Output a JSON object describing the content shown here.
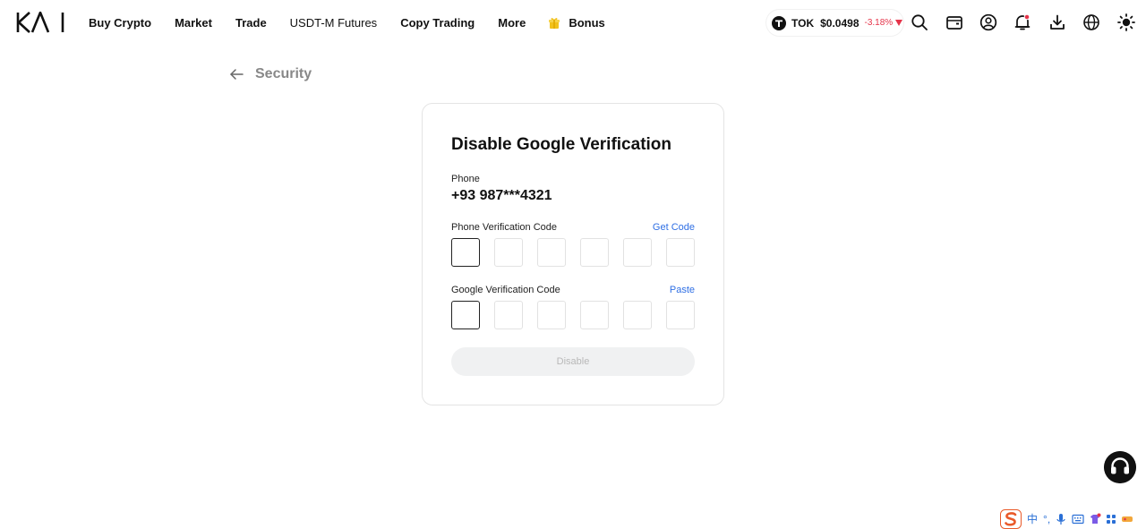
{
  "brand": {
    "logo_text": "KAI"
  },
  "nav": {
    "links": [
      {
        "label": "Buy Crypto"
      },
      {
        "label": "Market"
      },
      {
        "label": "Trade"
      },
      {
        "label": "USDT-M Futures"
      },
      {
        "label": "Copy Trading"
      },
      {
        "label": "More"
      }
    ],
    "bonus_label": "Bonus"
  },
  "ticker": {
    "symbol": "TOK",
    "price": "$0.0498",
    "change": "-3.18%"
  },
  "header_icons": [
    "search-icon",
    "wallet-icon",
    "account-icon",
    "notification-icon",
    "download-icon",
    "language-icon",
    "theme-icon"
  ],
  "page": {
    "section_title": "Security"
  },
  "card": {
    "title": "Disable Google Verification",
    "phone_label": "Phone",
    "phone_value": "+93 987***4321",
    "phone_code_label": "Phone Verification Code",
    "get_code_label": "Get Code",
    "google_code_label": "Google Verification Code",
    "paste_label": "Paste",
    "code_length": 6,
    "submit_label": "Disable"
  },
  "ime": {
    "items": [
      "中",
      "°,"
    ]
  },
  "colors": {
    "accent": "#2f6fe4",
    "negative": "#e5344a",
    "button_disabled_bg": "#f0f1f2",
    "bonus": "#f2c21b"
  }
}
